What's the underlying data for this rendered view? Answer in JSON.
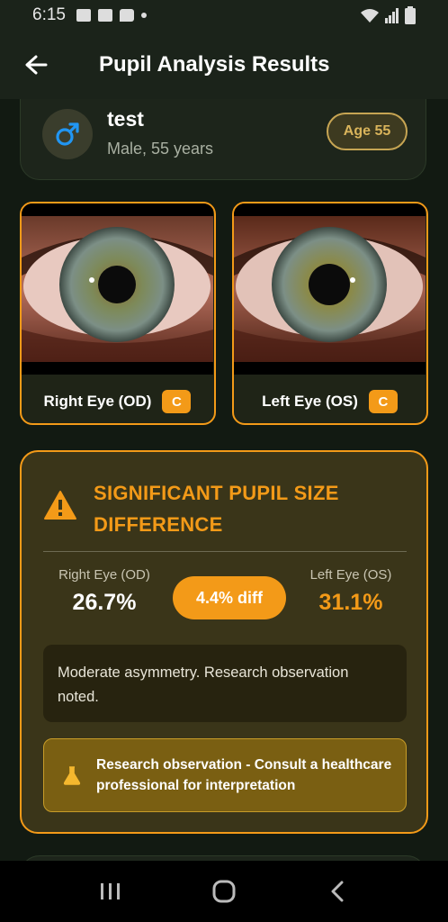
{
  "status_bar": {
    "time": "6:15"
  },
  "app_bar": {
    "title": "Pupil Analysis Results"
  },
  "profile": {
    "name": "test",
    "details": "Male, 55 years",
    "age_badge": "Age 55",
    "gender_icon": "male-symbol-icon"
  },
  "eyes": {
    "right": {
      "label": "Right Eye (OD)",
      "grade": "C"
    },
    "left": {
      "label": "Left Eye (OS)",
      "grade": "C"
    }
  },
  "alert": {
    "title": "SIGNIFICANT PUPIL SIZE DIFFERENCE",
    "right_label": "Right Eye (OD)",
    "right_value": "26.7%",
    "left_label": "Left Eye (OS)",
    "left_value": "31.1%",
    "diff": "4.4% diff",
    "note": "Moderate asymmetry. Research observation noted.",
    "research": "Research observation - Consult a healthcare professional for interpretation"
  },
  "colors": {
    "accent": "#f39a18",
    "background": "#121a12",
    "male_blue": "#2196f3"
  }
}
